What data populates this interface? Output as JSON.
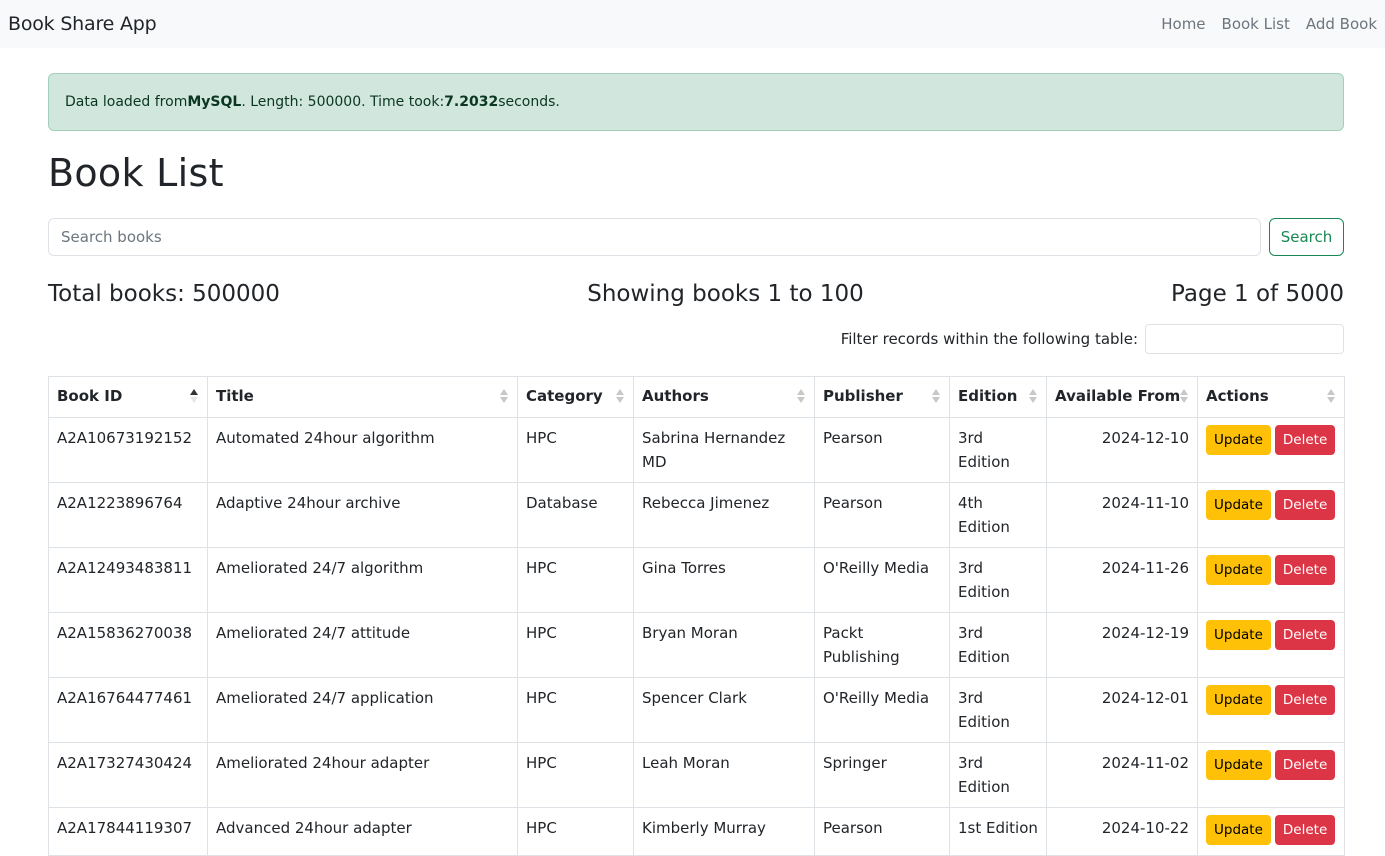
{
  "navbar": {
    "brand": "Book Share App",
    "links": [
      "Home",
      "Book List",
      "Add Book"
    ]
  },
  "alert": {
    "prefix": "Data loaded from ",
    "source": "MySQL",
    "middle": ". Length: 500000. Time took: ",
    "time": "7.2032",
    "suffix": " seconds."
  },
  "page_title": "Book List",
  "search": {
    "placeholder": "Search books",
    "button": "Search"
  },
  "stats": {
    "total": "Total books: 500000",
    "showing": "Showing books 1 to 100",
    "page": "Page 1 of 5000"
  },
  "filter": {
    "label": "Filter records within the following table:"
  },
  "table": {
    "columns": [
      "Book ID",
      "Title",
      "Category",
      "Authors",
      "Publisher",
      "Edition",
      "Available From",
      "Actions"
    ],
    "rows": [
      [
        "A2A10673192152",
        "Automated 24hour algorithm",
        "HPC",
        "Sabrina Hernandez MD",
        "Pearson",
        "3rd Edition",
        "2024-12-10"
      ],
      [
        "A2A1223896764",
        "Adaptive 24hour archive",
        "Database",
        "Rebecca Jimenez",
        "Pearson",
        "4th Edition",
        "2024-11-10"
      ],
      [
        "A2A12493483811",
        "Ameliorated 24/7 algorithm",
        "HPC",
        "Gina Torres",
        "O'Reilly Media",
        "3rd Edition",
        "2024-11-26"
      ],
      [
        "A2A15836270038",
        "Ameliorated 24/7 attitude",
        "HPC",
        "Bryan Moran",
        "Packt Publishing",
        "3rd Edition",
        "2024-12-19"
      ],
      [
        "A2A16764477461",
        "Ameliorated 24/7 application",
        "HPC",
        "Spencer Clark",
        "O'Reilly Media",
        "3rd Edition",
        "2024-12-01"
      ],
      [
        "A2A17327430424",
        "Ameliorated 24hour adapter",
        "HPC",
        "Leah Moran",
        "Springer",
        "3rd Edition",
        "2024-11-02"
      ],
      [
        "A2A17844119307",
        "Advanced 24hour adapter",
        "HPC",
        "Kimberly Murray",
        "Pearson",
        "1st Edition",
        "2024-10-22"
      ]
    ],
    "update_label": "Update",
    "delete_label": "Delete"
  },
  "colors": {
    "alert_bg": "#d1e7dd",
    "search_button": "#198754",
    "update_button": "#ffc107",
    "delete_button": "#dc3545"
  }
}
